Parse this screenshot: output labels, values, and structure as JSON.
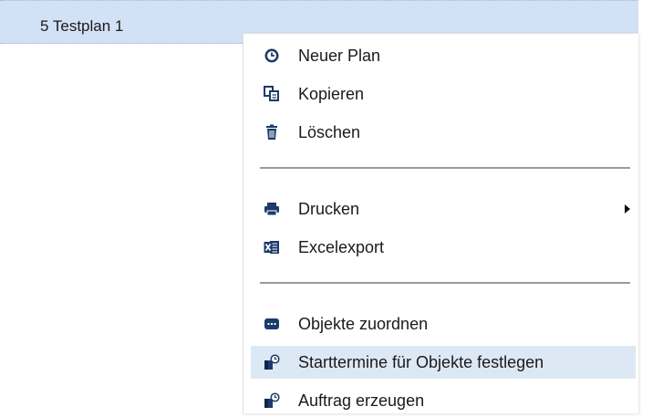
{
  "list": {
    "row_label": "5 Testplan 1"
  },
  "menu": {
    "items": [
      {
        "label": "Neuer Plan",
        "icon": "clock-icon"
      },
      {
        "label": "Kopieren",
        "icon": "copy-icon"
      },
      {
        "label": "Löschen",
        "icon": "trash-icon"
      },
      {
        "label": "Drucken",
        "icon": "printer-icon",
        "has_submenu": true
      },
      {
        "label": "Excelexport",
        "icon": "excel-icon"
      },
      {
        "label": "Objekte zuordnen",
        "icon": "link-icon"
      },
      {
        "label": "Starttermine für Objekte festlegen",
        "icon": "schedule-object-icon",
        "highlighted": true
      },
      {
        "label": "Auftrag erzeugen",
        "icon": "schedule-object-icon"
      }
    ]
  },
  "colors": {
    "selected_row": "#d3e1f7",
    "hover_item": "#dde8f5",
    "icon": "#1c3a6b",
    "excel_green": "#1e6e43"
  }
}
